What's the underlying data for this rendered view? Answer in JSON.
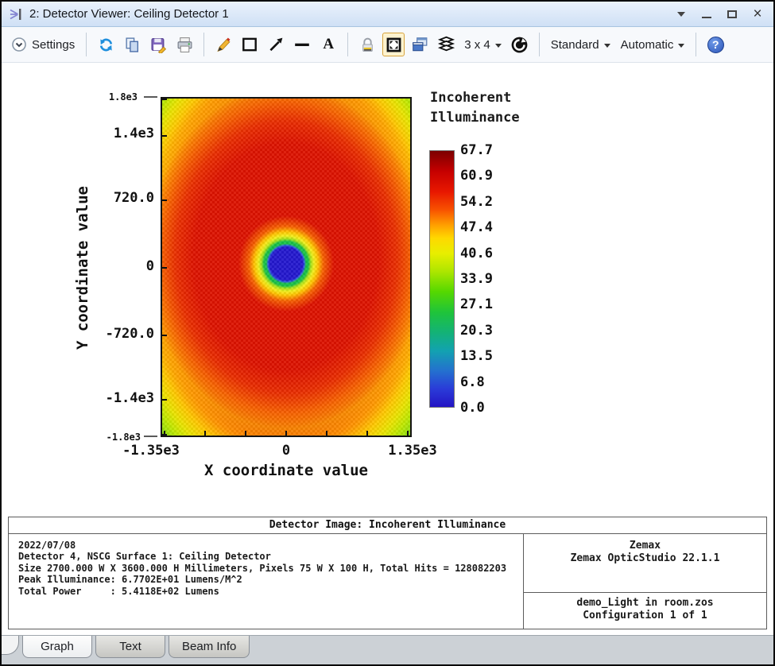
{
  "window": {
    "title": "2: Detector Viewer: Ceiling Detector 1"
  },
  "toolbar": {
    "settings_label": "Settings",
    "grid_label": "3 x 4",
    "mode_label": "Standard",
    "scale_label": "Automatic"
  },
  "icons": {
    "titlebar": "detector-rays-icon",
    "toolbar": [
      "settings-chevron-icon",
      "refresh-icon",
      "copy-icon",
      "save-icon",
      "print-icon",
      "pencil-icon",
      "rectangle-icon",
      "arrow-icon",
      "line-icon",
      "text-icon",
      "lock-icon",
      "fit-window-icon",
      "clone-window-icon",
      "layers-icon",
      "reset-icon",
      "help-icon"
    ],
    "window_controls": [
      "menu-down-icon",
      "minimize-icon",
      "maximize-icon",
      "close-icon"
    ]
  },
  "colors": {
    "titlebar_bg": "#cfe0f5",
    "active_tool_highlight": "#d8a33b",
    "colorbar_top": "#7c0000",
    "colorbar_bottom": "#2414c4",
    "center_null": "#2418cf"
  },
  "plot": {
    "y_axis_title": "Y coordinate value",
    "x_axis_title": "X coordinate value",
    "y_ticks": [
      "1.8e3",
      "1.4e3",
      "720.0",
      "0",
      "-720.0",
      "-1.4e3",
      "-1.8e3"
    ],
    "x_ticks": [
      "-1.35e3",
      "0",
      "1.35e3"
    ]
  },
  "legend": {
    "title": "Incoherent\nIlluminance",
    "ticks": [
      "67.7",
      "60.9",
      "54.2",
      "47.4",
      "40.6",
      "33.9",
      "27.1",
      "20.3",
      "13.5",
      "6.8",
      "0.0"
    ]
  },
  "info": {
    "header": "Detector Image: Incoherent Illuminance",
    "lines": [
      "2022/07/08",
      "Detector 4, NSCG Surface 1: Ceiling Detector",
      "Size 2700.000 W X 3600.000 H Millimeters, Pixels 75 W X 100 H, Total Hits = 128082203",
      "Peak Illuminance: 6.7702E+01 Lumens/M^2",
      "Total Power     : 5.4118E+02 Lumens"
    ],
    "company": "Zemax",
    "product": "Zemax OpticStudio 22.1.1",
    "file": "demo_Light in room.zos",
    "configuration": "Configuration 1 of 1"
  },
  "tabs": {
    "graph": "Graph",
    "text": "Text",
    "beam_info": "Beam Info"
  },
  "chart_data": {
    "type": "heatmap",
    "title": "Detector Image: Incoherent Illuminance",
    "xlabel": "X coordinate value",
    "ylabel": "Y coordinate value",
    "x_range_mm": [
      -1350,
      1350
    ],
    "y_range_mm": [
      -1800,
      1800
    ],
    "x_tick_labels": [
      "-1.35e3",
      "0",
      "1.35e3"
    ],
    "y_tick_labels": [
      "1.8e3",
      "1.4e3",
      "720.0",
      "0",
      "-720.0",
      "-1.4e3",
      "-1.8e3"
    ],
    "pixels": {
      "w": 75,
      "h": 100
    },
    "colorbar": {
      "title": "Incoherent Illuminance",
      "units": "Lumens/M^2",
      "min": 0.0,
      "max": 67.7,
      "tick_values": [
        67.7,
        60.9,
        54.2,
        47.4,
        40.6,
        33.9,
        27.1,
        20.3,
        13.5,
        6.8,
        0.0
      ],
      "palette_top_to_bottom": [
        "#7c0000",
        "#e81800",
        "#ff8c00",
        "#ffd800",
        "#aee600",
        "#3ccf20",
        "#13b277",
        "#12a2b0",
        "#2470cf",
        "#2414c4"
      ]
    },
    "peak_illuminance": "6.7702E+01 Lumens/M^2",
    "total_power": "5.4118E+02 Lumens",
    "total_hits": 128082203,
    "distribution_summary": "Near-peak red field (~55-68 lm/m^2) over most of the detector; illuminance falls to yellow-green (~30-45) along edges and corners; circular null (~0, dark blue, radius ~150 mm) at detector center ringed by green then yellow halo."
  }
}
